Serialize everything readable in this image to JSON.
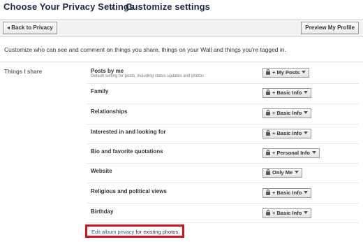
{
  "header": {
    "title_primary": "Choose Your Privacy Settings",
    "title_secondary": "Customize settings"
  },
  "toolbar": {
    "back_label": "Back to Privacy",
    "back_arrow": "◂",
    "preview_label": "Preview My Profile"
  },
  "intro_text": "Customize who can see and comment on things you share, things on your Wall and things you're tagged in.",
  "section": {
    "label": "Things I share"
  },
  "rows": [
    {
      "title": "Posts by me",
      "subtitle": "Default setting for posts, including status updates and photos",
      "privacy": "+ My Posts"
    },
    {
      "title": "Family",
      "privacy": "+ Basic Info"
    },
    {
      "title": "Relationships",
      "privacy": "+ Basic Info"
    },
    {
      "title": "Interested in and looking for",
      "privacy": "+ Basic Info"
    },
    {
      "title": "Bio and favorite quotations",
      "privacy": "+ Personal Info"
    },
    {
      "title": "Website",
      "privacy": "Only Me"
    },
    {
      "title": "Religious and political views",
      "privacy": "+ Basic Info"
    },
    {
      "title": "Birthday",
      "privacy": "+ Basic Info"
    }
  ],
  "album": {
    "link_text": "Edit album privacy",
    "suffix_text": " for existing photos."
  },
  "colors": {
    "link": "#3b5998",
    "highlight_box": "#d8101e",
    "title": "#1c2a47"
  }
}
